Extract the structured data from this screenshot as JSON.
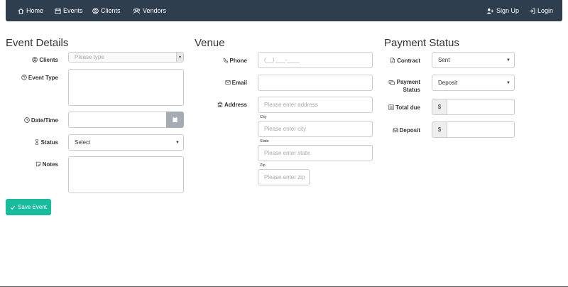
{
  "nav": {
    "home": "Home",
    "events": "Events",
    "clients": "Clients",
    "vendors": "Vendors",
    "signup": "Sign Up",
    "login": "Login"
  },
  "event_details": {
    "title": "Event Details",
    "clients_label": "Clients",
    "clients_placeholder": "Please type",
    "event_type_label": "Event Type",
    "datetime_label": "Date/Time",
    "status_label": "Status",
    "status_value": "Select",
    "notes_label": "Notes",
    "save_label": "Save Event"
  },
  "venue": {
    "title": "Venue",
    "phone_label": "Phone",
    "phone_placeholder": "(__) ___-____",
    "email_label": "Email",
    "address_label": "Address",
    "address_placeholder": "Please enter address",
    "city_label": "City",
    "city_placeholder": "Please enter city",
    "state_label": "State",
    "state_placeholder": "Please enter state",
    "zip_label": "Zip",
    "zip_placeholder": "Please enter zip"
  },
  "payment": {
    "title": "Payment Status",
    "contract_label": "Contract",
    "contract_value": "Sent",
    "payment_status_label_1": "Payment",
    "payment_status_label_2": "Status",
    "payment_status_value": "Deposit",
    "total_due_label": "Total due",
    "deposit_label": "Deposit",
    "currency": "$"
  },
  "colors": {
    "navbar": "#2f3e4e",
    "accent": "#18bc9c",
    "calendar_button": "#a5acb3"
  }
}
